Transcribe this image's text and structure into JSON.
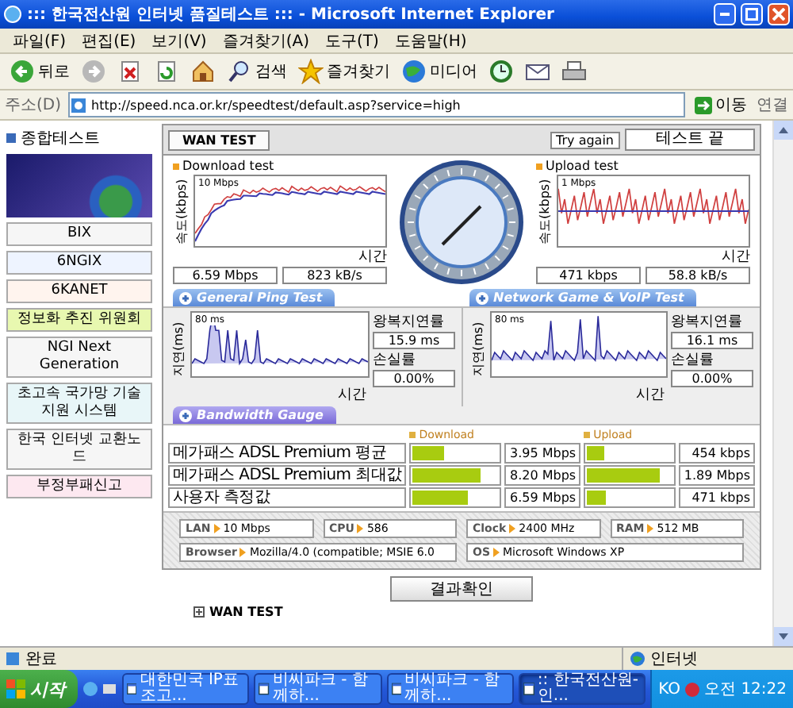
{
  "window": {
    "title": "::: 한국전산원 인터넷 품질테스트 ::: - Microsoft Internet Explorer"
  },
  "menu": [
    "파일(F)",
    "편집(E)",
    "보기(V)",
    "즐겨찾기(A)",
    "도구(T)",
    "도움말(H)"
  ],
  "toolbar": [
    {
      "kind": "back",
      "label": "뒤로"
    },
    {
      "kind": "forward"
    },
    {
      "kind": "stop"
    },
    {
      "kind": "refresh"
    },
    {
      "kind": "home"
    },
    {
      "kind": "search",
      "label": "검색"
    },
    {
      "kind": "favorites",
      "label": "즐겨찾기"
    },
    {
      "kind": "media",
      "label": "미디어"
    },
    {
      "kind": "history"
    },
    {
      "kind": "mail"
    },
    {
      "kind": "print"
    }
  ],
  "address": {
    "label": "주소(D)",
    "url": "http://speed.nca.or.kr/speedtest/default.asp?service=high",
    "go": "이동",
    "links": "연결"
  },
  "sidebar": {
    "heading": "종합테스트",
    "banners": [
      {
        "kind": "picture"
      },
      {
        "kind": "text",
        "label": "BIX"
      },
      {
        "kind": "text",
        "label": "6NGIX"
      },
      {
        "kind": "text",
        "label": "6KANET"
      },
      {
        "kind": "text",
        "label": "정보화 추진 위원회"
      },
      {
        "kind": "text",
        "label": "NGI Next Generation"
      },
      {
        "kind": "text",
        "label": "초고속 국가망 기술지원 시스템"
      },
      {
        "kind": "text",
        "label": "한국 인터넷 교환노드"
      },
      {
        "kind": "text",
        "label": "부정부패신고"
      }
    ]
  },
  "test": {
    "tab": "WAN TEST",
    "try_again": "Try again",
    "status": "테스트 끝",
    "graphs": [
      {
        "title": "Download test",
        "axis": "속도(kbps)",
        "max": "10 Mbps",
        "xlabel": "시간",
        "values": [
          "6.59 Mbps",
          "823 kB/s"
        ]
      },
      {
        "title": "Upload test",
        "axis": "속도(kbps)",
        "max": "1 Mbps",
        "xlabel": "시간",
        "values": [
          "471 kbps",
          "58.8 kB/s"
        ]
      }
    ],
    "ping_tabs": [
      "General Ping Test",
      "Network Game & VoIP Test"
    ],
    "pings": [
      {
        "axis": "지연(ms)",
        "max": "80 ms",
        "xlabel": "시간",
        "rtt_label": "왕복지연률",
        "rtt": "15.9 ms",
        "loss_label": "손실률",
        "loss": "0.00%"
      },
      {
        "axis": "지연(ms)",
        "max": "80 ms",
        "xlabel": "시간",
        "rtt_label": "왕복지연률",
        "rtt": "16.1 ms",
        "loss_label": "손실률",
        "loss": "0.00%"
      }
    ],
    "bandwidth_tab": "Bandwidth Gauge",
    "columns": [
      "Download",
      "Upload"
    ],
    "rows": [
      {
        "label": "메가패스 ADSL Premium 평균",
        "download": {
          "level": 0.36,
          "reading": "3.95 Mbps"
        },
        "upload": {
          "level": 0.2,
          "reading": "454 kbps"
        }
      },
      {
        "label": "메가패스 ADSL Premium 최대값",
        "download": {
          "level": 0.8,
          "reading": "8.20 Mbps"
        },
        "upload": {
          "level": 0.85,
          "reading": "1.89 Mbps"
        }
      },
      {
        "label": "사용자 측정값",
        "download": {
          "level": 0.64,
          "reading": "6.59 Mbps"
        },
        "upload": {
          "level": 0.22,
          "reading": "471 kbps"
        }
      }
    ],
    "system": [
      {
        "key": "LAN",
        "value": "10 Mbps"
      },
      {
        "key": "CPU",
        "value": "586"
      },
      {
        "key": "Clock",
        "value": "2400 MHz"
      },
      {
        "key": "RAM",
        "value": "512 MB"
      },
      {
        "key": "Browser",
        "value": "Mozilla/4.0 (compatible; MSIE 6.0"
      },
      {
        "key": "OS",
        "value": "Microsoft Windows XP"
      }
    ],
    "result_button": "결과확인",
    "footer_heading": "WAN TEST"
  },
  "status_bar": {
    "text": "완료",
    "zone": "인터넷"
  },
  "taskbar": {
    "start": "시작",
    "tasks": [
      {
        "label": "대한민국 IP표 조고...",
        "selected": false
      },
      {
        "label": "비씨파크 - 함께하...",
        "selected": false
      },
      {
        "label": "비씨파크 - 함께하...",
        "selected": false
      },
      {
        "label": ":: 한국전산원-인...",
        "selected": true
      }
    ],
    "tray": "KO",
    "clock": "오전 12:22"
  }
}
